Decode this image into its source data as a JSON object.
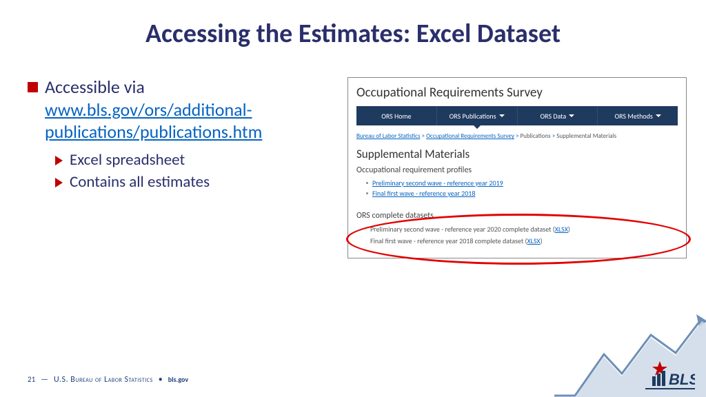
{
  "title": "Accessing the Estimates: Excel Dataset",
  "bullet1_lead": "Accessible via ",
  "bullet1_link": "www.bls.gov/ors/additional-publications/publications.htm",
  "sub_bullets": [
    "Excel spreadsheet",
    "Contains all estimates"
  ],
  "screenshot": {
    "heading": "Occupational Requirements Survey",
    "nav": [
      "ORS Home",
      "ORS Publications",
      "ORS Data",
      "ORS Methods"
    ],
    "crumbs": {
      "a": "Bureau of Labor Statistics",
      "b": "Occupational Requirements Survey",
      "c": "Publications",
      "d": "Supplemental Materials"
    },
    "subhead": "Supplemental Materials",
    "profiles_label": "Occupational requirement profiles",
    "profiles": [
      "Preliminary second wave - reference year 2019",
      "Final first wave - reference year 2018"
    ],
    "datasets_label": "ORS complete datasets",
    "datasets": [
      {
        "text": "Preliminary second wave - reference year 2020 complete dataset",
        "fmt": "XLSX"
      },
      {
        "text": "Final first wave - reference year 2018 complete dataset",
        "fmt": "XLSX"
      }
    ]
  },
  "footer": {
    "page": "21",
    "dash": "—",
    "org": "U.S. Bureau of Labor Statistics",
    "site": "bls.gov"
  }
}
